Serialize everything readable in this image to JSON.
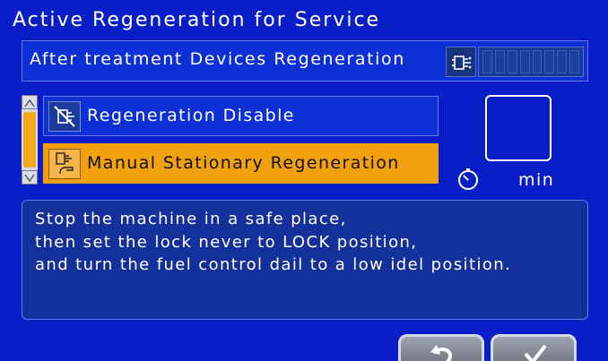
{
  "header": {
    "title": "Active Regeneration for Service"
  },
  "aftertreatment": {
    "label": "After treatment Devices Regeneration",
    "icon": "regeneration-icon",
    "level_segments": 8,
    "level_filled": 0
  },
  "options": [
    {
      "label": "Regeneration Disable",
      "icon": "regeneration-disable-icon",
      "selected": false
    },
    {
      "label": "Manual Stationary Regeneration",
      "icon": "manual-regeneration-icon",
      "selected": true
    }
  ],
  "timer": {
    "value": "",
    "unit": "min",
    "icon": "timer-icon"
  },
  "message": {
    "lines": [
      "Stop the machine in a safe place,",
      "then set the lock never to LOCK position,",
      "and turn the fuel control dail to a low idel position."
    ]
  },
  "buttons": {
    "back_icon": "return-icon",
    "ok_icon": "check-icon"
  },
  "colors": {
    "background": "#0a1ec8",
    "selected": "#f2a10e",
    "panel": "#0d2fd6",
    "message_bg": "#14309a"
  }
}
